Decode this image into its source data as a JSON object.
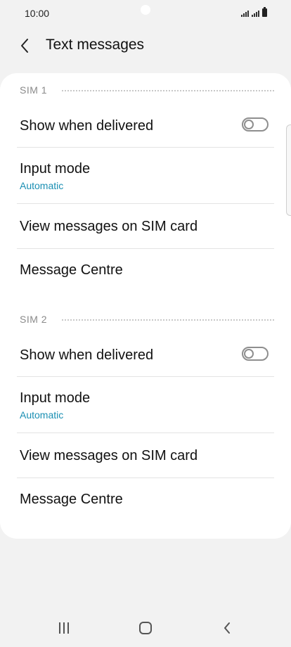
{
  "status": {
    "time": "10:00"
  },
  "header": {
    "title": "Text messages"
  },
  "sections": [
    {
      "label": "SIM 1",
      "show_delivered": "Show when delivered",
      "input_mode": "Input mode",
      "input_mode_value": "Automatic",
      "view_messages": "View messages on SIM card",
      "message_centre": "Message Centre",
      "show_delivered_enabled": false
    },
    {
      "label": "SIM 2",
      "show_delivered": "Show when delivered",
      "input_mode": "Input mode",
      "input_mode_value": "Automatic",
      "view_messages": "View messages on SIM card",
      "message_centre": "Message Centre",
      "show_delivered_enabled": false
    }
  ],
  "icons": {
    "back": "chevron-left-icon",
    "recents": "recent-apps-icon",
    "home": "home-icon",
    "nav_back": "back-icon"
  },
  "colors": {
    "accent": "#1a8fb3",
    "background": "#f2f2f2",
    "card": "#ffffff"
  }
}
